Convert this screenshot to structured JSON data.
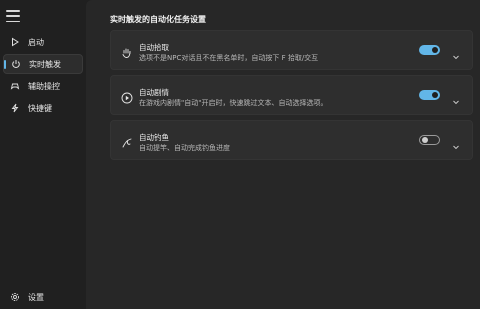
{
  "sidebar": {
    "items": [
      {
        "label": "启动",
        "icon": "play-icon"
      },
      {
        "label": "实时触发",
        "icon": "power-icon",
        "active": true
      },
      {
        "label": "辅助操控",
        "icon": "gamepad-icon"
      },
      {
        "label": "快捷键",
        "icon": "lightning-icon"
      }
    ],
    "settings_label": "设置"
  },
  "main": {
    "section_title": "实时触发的自动化任务设置",
    "cards": [
      {
        "title": "自动拾取",
        "desc": "选项不是NPC对话且不在黑名单时，自动按下 F 拾取/交互",
        "enabled": true,
        "icon": "hand-icon"
      },
      {
        "title": "自动剧情",
        "desc": "在游戏内剧情\"自动\"开启时，快速跳过文本、自动选择选项。",
        "enabled": true,
        "icon": "play-circle-icon"
      },
      {
        "title": "自动钓鱼",
        "desc": "自动提竿、自动完成钓鱼进度",
        "enabled": false,
        "icon": "fishing-icon"
      }
    ]
  },
  "colors": {
    "accent": "#62b6e8",
    "background": "#202020",
    "panel": "#272727",
    "card": "#2e2e2e"
  }
}
